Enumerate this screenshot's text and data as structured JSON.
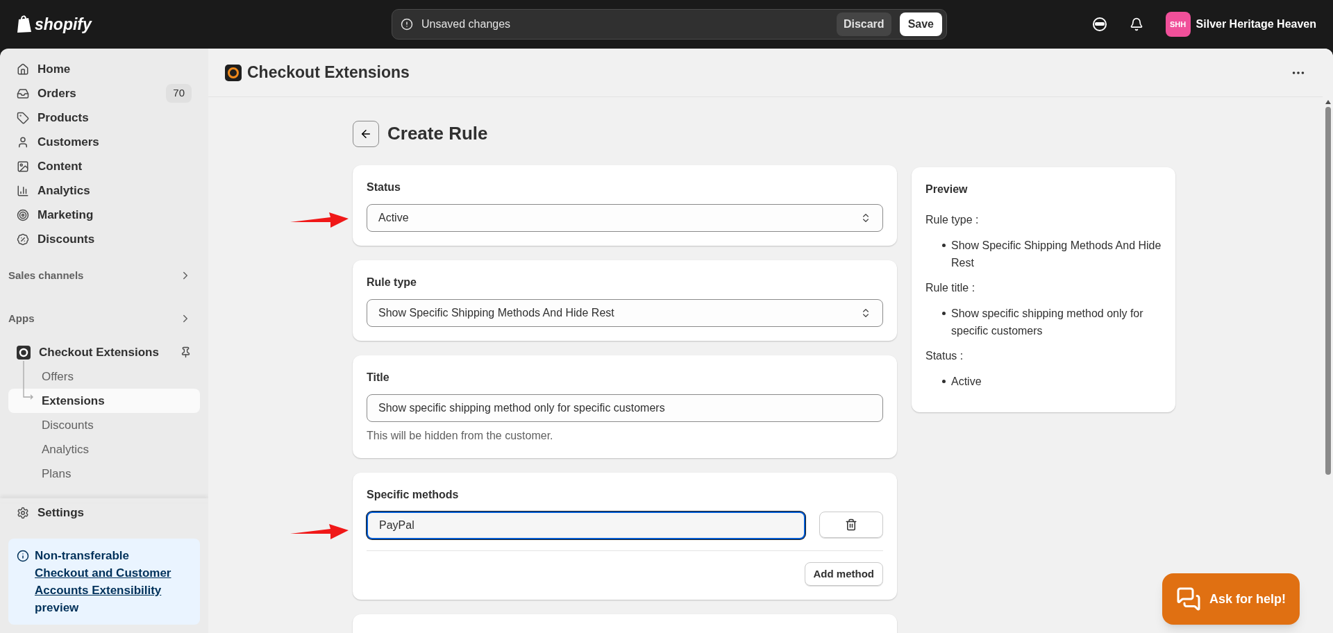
{
  "topbar": {
    "brand": "shopify",
    "notice": "Unsaved changes",
    "discard": "Discard",
    "save": "Save",
    "store_initials": "SHH",
    "store_name": "Silver Heritage Heaven"
  },
  "sidebar": {
    "items": [
      {
        "label": "Home"
      },
      {
        "label": "Orders",
        "badge": "70"
      },
      {
        "label": "Products"
      },
      {
        "label": "Customers"
      },
      {
        "label": "Content"
      },
      {
        "label": "Analytics"
      },
      {
        "label": "Marketing"
      },
      {
        "label": "Discounts"
      }
    ],
    "sections": [
      "Sales channels",
      "Apps"
    ],
    "app": {
      "label": "Checkout Extensions",
      "children": [
        {
          "label": "Offers",
          "selected": false
        },
        {
          "label": "Extensions",
          "selected": true
        },
        {
          "label": "Discounts",
          "selected": false
        },
        {
          "label": "Analytics",
          "selected": false
        },
        {
          "label": "Plans",
          "selected": false
        }
      ]
    },
    "settings": "Settings",
    "notice": {
      "title": "Non-transferable",
      "link": "Checkout and Customer Accounts Extensibility",
      "tail": "preview"
    }
  },
  "header": {
    "title": "Checkout Extensions"
  },
  "page": {
    "title": "Create Rule"
  },
  "form": [
    {
      "kind": "select",
      "label": "Status",
      "value": "Active",
      "arrow": true
    },
    {
      "kind": "select",
      "label": "Rule type",
      "value": "Show Specific Shipping Methods And Hide Rest",
      "arrow": false
    },
    {
      "kind": "text",
      "label": "Title",
      "value": "Show specific shipping method only for specific customers",
      "help": "This will be hidden from the customer.",
      "arrow": false
    },
    {
      "kind": "methods",
      "label": "Specific methods",
      "value": "PayPal",
      "focused": true,
      "arrow": true,
      "add": "Add method"
    }
  ],
  "preview": {
    "title": "Preview",
    "groups": [
      {
        "label": "Rule type :",
        "items": [
          "Show Specific Shipping Methods And Hide Rest"
        ]
      },
      {
        "label": "Rule title :",
        "items": [
          "Show specific shipping method only for specific customers"
        ]
      },
      {
        "label": "Status :",
        "items": [
          "Active"
        ]
      }
    ]
  },
  "help_button": "Ask for help!"
}
